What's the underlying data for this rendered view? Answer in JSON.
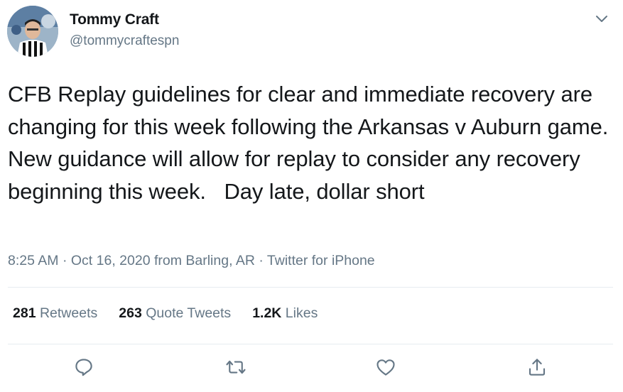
{
  "author": {
    "display_name": "Tommy Craft",
    "handle": "@tommycraftespn",
    "avatar": "referee-avatar"
  },
  "tweet": {
    "text": "CFB Replay guidelines for clear and immediate recovery are changing for this week following the Arkansas v Auburn game.  New guidance will allow for replay to consider any recovery beginning this week.   Day late, dollar short"
  },
  "meta": {
    "time": "8:25 AM",
    "separator1": " · ",
    "date_location": "Oct 16, 2020 from Barling, AR",
    "separator2": " · ",
    "source": "Twitter for iPhone"
  },
  "stats": {
    "retweets": {
      "count": "281",
      "label": " Retweets"
    },
    "quote_tweets": {
      "count": "263",
      "label": " Quote Tweets"
    },
    "likes": {
      "count": "1.2K",
      "label": " Likes"
    }
  },
  "icons": {
    "caret": "chevron-down-icon",
    "reply": "reply-icon",
    "retweet": "retweet-icon",
    "like": "heart-icon",
    "share": "share-icon"
  },
  "colors": {
    "text": "#14171a",
    "secondary": "#657786",
    "divider": "#e6ecf0"
  }
}
